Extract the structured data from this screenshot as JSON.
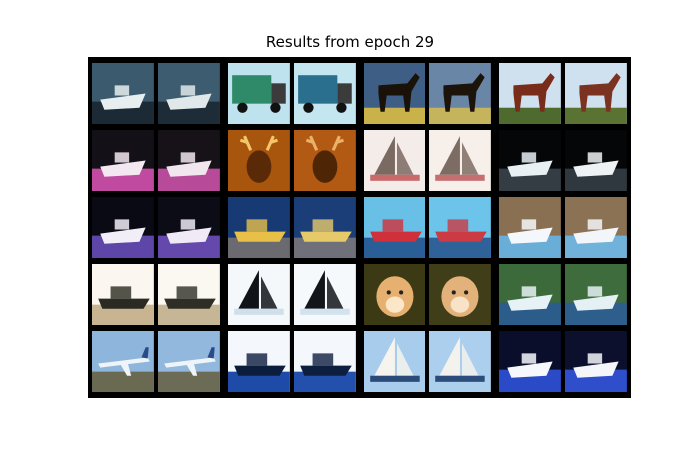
{
  "figure": {
    "title": "Results from epoch 29"
  },
  "grid": {
    "rows": 5,
    "pairs_per_row": 4,
    "panels": [
      [
        {
          "subject": "boat",
          "colors": [
            "#3b5a6e",
            "#e6eef0",
            "#1c2a36"
          ]
        },
        {
          "subject": "boat",
          "colors": [
            "#3d5c70",
            "#e0e8ea",
            "#1e2c38"
          ]
        },
        {
          "subject": "truck",
          "colors": [
            "#bfe3ee",
            "#2f8a6a",
            "#3b3b3b"
          ]
        },
        {
          "subject": "truck",
          "colors": [
            "#c4e6f0",
            "#2b6f8f",
            "#3b3b3b"
          ]
        },
        {
          "subject": "horse",
          "colors": [
            "#3e5e86",
            "#1a1208",
            "#c9b24a"
          ]
        },
        {
          "subject": "horse",
          "colors": [
            "#6a86a6",
            "#1c140a",
            "#c6b45c"
          ]
        },
        {
          "subject": "horse",
          "colors": [
            "#cfe0ee",
            "#7a2c1a",
            "#4e6a2e"
          ]
        },
        {
          "subject": "horse",
          "colors": [
            "#cfe0ee",
            "#7c3220",
            "#5a7232"
          ]
        }
      ],
      [
        {
          "subject": "boat",
          "colors": [
            "#141018",
            "#f4e8f0",
            "#c04aa0"
          ]
        },
        {
          "subject": "boat",
          "colors": [
            "#161218",
            "#f2e6ee",
            "#b84a9a"
          ]
        },
        {
          "subject": "deer",
          "colors": [
            "#a8560e",
            "#5a2a08",
            "#f4c66a"
          ]
        },
        {
          "subject": "deer",
          "colors": [
            "#b25a14",
            "#4e2606",
            "#eab266"
          ]
        },
        {
          "subject": "sailboat",
          "colors": [
            "#f4ece8",
            "#7a6a62",
            "#c86a6a"
          ]
        },
        {
          "subject": "sailboat",
          "colors": [
            "#f6efea",
            "#7c6c64",
            "#c47070"
          ]
        },
        {
          "subject": "boat",
          "colors": [
            "#050608",
            "#e8f0f4",
            "#343c44"
          ]
        },
        {
          "subject": "boat",
          "colors": [
            "#050608",
            "#eef2f4",
            "#30383f"
          ]
        }
      ],
      [
        {
          "subject": "boat",
          "colors": [
            "#0a0a14",
            "#f2eef8",
            "#5e46a8"
          ]
        },
        {
          "subject": "boat",
          "colors": [
            "#0c0c16",
            "#efeaf6",
            "#6448ac"
          ]
        },
        {
          "subject": "ship",
          "colors": [
            "#183a74",
            "#e8c048",
            "#6a6a70"
          ]
        },
        {
          "subject": "ship",
          "colors": [
            "#1c3e78",
            "#e6ca6a",
            "#70707a"
          ]
        },
        {
          "subject": "ship",
          "colors": [
            "#68c0e6",
            "#d0303a",
            "#2a5e96"
          ]
        },
        {
          "subject": "ship",
          "colors": [
            "#6cc4ea",
            "#cc3a44",
            "#2e6298"
          ]
        },
        {
          "subject": "boat",
          "colors": [
            "#8a7052",
            "#f4f8fc",
            "#6aaed8"
          ]
        },
        {
          "subject": "boat",
          "colors": [
            "#8c7254",
            "#f2f6fa",
            "#70b2da"
          ]
        }
      ],
      [
        {
          "subject": "ship",
          "colors": [
            "#fbf7f0",
            "#2a2a22",
            "#c8b490"
          ]
        },
        {
          "subject": "ship",
          "colors": [
            "#fbf8f2",
            "#2e2e26",
            "#c6b696"
          ]
        },
        {
          "subject": "sailboat",
          "colors": [
            "#f4f8fa",
            "#101418",
            "#cfe0ec"
          ]
        },
        {
          "subject": "sailboat",
          "colors": [
            "#f6f9fb",
            "#12161a",
            "#d2e2ee"
          ]
        },
        {
          "subject": "dog",
          "colors": [
            "#3c3a14",
            "#e6b070",
            "#fbe6c8"
          ]
        },
        {
          "subject": "dog",
          "colors": [
            "#403e18",
            "#e2b27a",
            "#f8e2c8"
          ]
        },
        {
          "subject": "boat",
          "colors": [
            "#3c6a3a",
            "#e6f2f6",
            "#2c5c8a"
          ]
        },
        {
          "subject": "boat",
          "colors": [
            "#3e6c3c",
            "#e4f0f4",
            "#2e5e8c"
          ]
        }
      ],
      [
        {
          "subject": "airplane",
          "colors": [
            "#8eb6dc",
            "#eef4f8",
            "#6a6a52"
          ]
        },
        {
          "subject": "airplane",
          "colors": [
            "#92b8de",
            "#eef4f8",
            "#6c6c56"
          ]
        },
        {
          "subject": "ship",
          "colors": [
            "#f4f8fc",
            "#0c1c3c",
            "#1e4aa8"
          ]
        },
        {
          "subject": "ship",
          "colors": [
            "#f4f8fc",
            "#0e1e3e",
            "#2250ac"
          ]
        },
        {
          "subject": "sailboat",
          "colors": [
            "#a8ccec",
            "#f6f4ee",
            "#2a4a7a"
          ]
        },
        {
          "subject": "sailboat",
          "colors": [
            "#accfee",
            "#f4f2ec",
            "#2c4c7c"
          ]
        },
        {
          "subject": "boat",
          "colors": [
            "#0a0e2a",
            "#f6f8fc",
            "#2a4ac8"
          ]
        },
        {
          "subject": "boat",
          "colors": [
            "#0c102c",
            "#f4f6fa",
            "#2e4ecc"
          ]
        }
      ]
    ]
  }
}
